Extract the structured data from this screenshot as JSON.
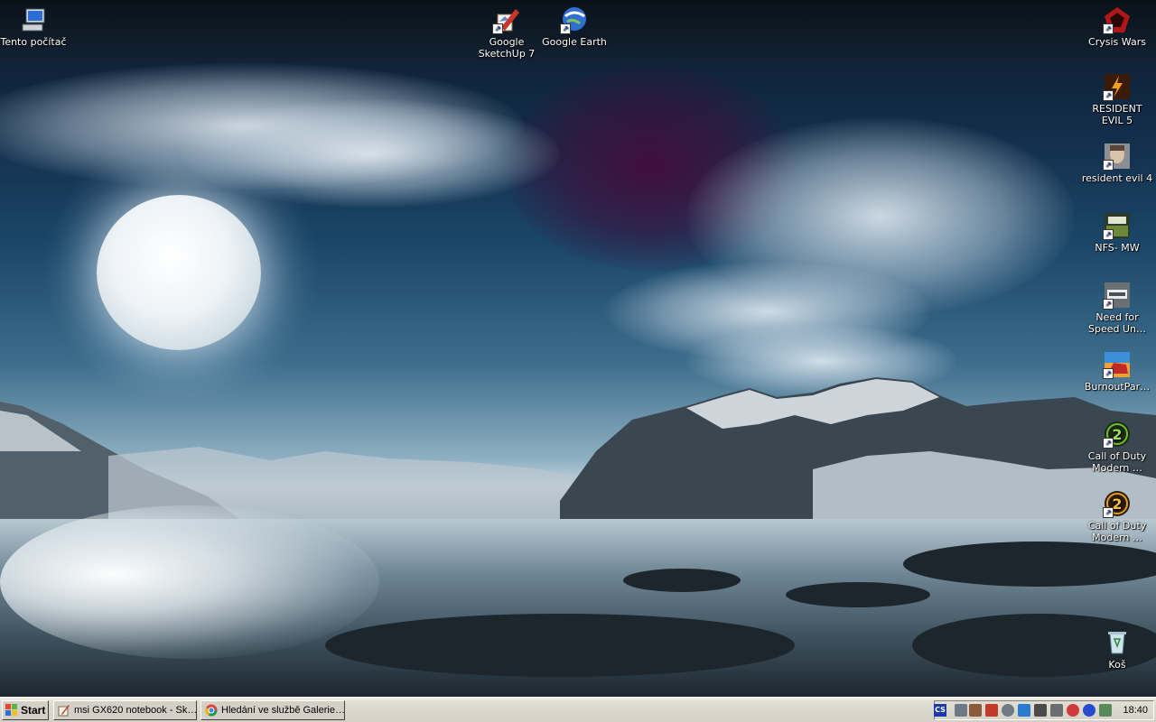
{
  "desktop": {
    "icons": [
      {
        "label": "Tento počítač",
        "icon": "my-computer-icon"
      },
      {
        "label": "Google SketchUp 7",
        "icon": "sketchup-icon"
      },
      {
        "label": "Google Earth",
        "icon": "google-earth-icon"
      },
      {
        "label": "Crysis Wars",
        "icon": "crysis-wars-icon"
      },
      {
        "label": "RESIDENT EVIL 5",
        "icon": "resident-evil-5-icon"
      },
      {
        "label": "resident evil 4",
        "icon": "resident-evil-4-icon"
      },
      {
        "label": "NFS- MW",
        "icon": "nfs-mw-icon"
      },
      {
        "label": "Need for Speed Un…",
        "icon": "nfs-undercover-icon"
      },
      {
        "label": "BurnoutPar…",
        "icon": "burnout-paradise-icon"
      },
      {
        "label": "Call of Duty Modern …",
        "icon": "cod-mw2-icon"
      },
      {
        "label": "Call of Duty Modern …",
        "icon": "cod-mw2-mp-icon"
      },
      {
        "label": "Koš",
        "icon": "recycle-bin-icon"
      }
    ],
    "shortcut_glyph": "↗"
  },
  "taskbar": {
    "start_label": "Start",
    "tasks": [
      {
        "label": "msi GX620 notebook - Sk…",
        "icon": "paint-icon"
      },
      {
        "label": "Hledání ve službě Galerie…",
        "icon": "chrome-icon"
      }
    ],
    "tray": {
      "language": "CS",
      "icons": [
        "network-icon",
        "display-icon",
        "antivirus-icon",
        "media-icon",
        "bluetooth-icon",
        "volume-icon",
        "usb-icon",
        "security-icon",
        "shield-icon",
        "firewall-icon"
      ],
      "clock": "18:40"
    }
  },
  "colors": {
    "taskbar": "#d4d0c8",
    "icon_label_text": "#ffffff"
  }
}
